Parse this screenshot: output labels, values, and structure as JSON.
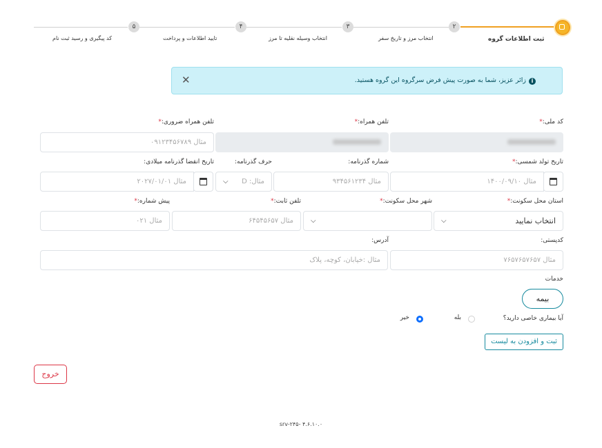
{
  "stepper": {
    "steps": [
      {
        "number": "",
        "label": "ثبت اطلاعات گروه"
      },
      {
        "number": "۲",
        "label": "انتخاب مرز و تاریخ سفر"
      },
      {
        "number": "۳",
        "label": "انتخاب وسیله نقلیه تا مرز"
      },
      {
        "number": "۴",
        "label": "تایید اطلاعات و پرداخت"
      },
      {
        "number": "۵",
        "label": "کد پیگیری و رسید ثبت نام"
      }
    ]
  },
  "alert": {
    "text": "زائر عزیز، شما به صورت پیش فرض سرگروه این گروه هستید.",
    "info_icon": "i",
    "close_icon": "✕"
  },
  "form": {
    "national_code": {
      "label": "کد ملی:",
      "required": "*"
    },
    "mobile": {
      "label": "تلفن همراه:",
      "required": "*"
    },
    "emergency_mobile": {
      "label": "تلفن همراه ضروری:",
      "required": "*",
      "placeholder": "مثال ۰۹۱۲۳۴۵۶۷۸۹"
    },
    "birth_date": {
      "label": "تاریخ تولد شمسی:",
      "required": "*",
      "placeholder": "مثال ۱۴۰۰/۰۹/۱۰"
    },
    "passport_number": {
      "label": "شماره گذرنامه:",
      "placeholder": "مثال ۹۳۴۵۶۱۲۳۴"
    },
    "passport_letter": {
      "label": "حرف گذرنامه:",
      "placeholder": "مثال: D"
    },
    "passport_expiry": {
      "label": "تاریخ انقضا گذرنامه میلادی:",
      "placeholder": "مثال ۲۰۲۷/۰۱/۰۱"
    },
    "province": {
      "label": "استان محل سکونت:",
      "required": "*",
      "value": "انتخاب نمایید"
    },
    "city": {
      "label": "شهر محل سکونت:",
      "required": "*",
      "value": ""
    },
    "phone": {
      "label": "تلفن ثابت:",
      "required": "*",
      "placeholder": "مثال ۶۴۵۴۵۶۵۷"
    },
    "area_code": {
      "label": "پیش شماره:",
      "required": "*",
      "placeholder": "مثال ۰۲۱"
    },
    "postal_code": {
      "label": "کدپستی:",
      "placeholder": "مثال ۷۶۵۷۶۵۷۶۵۷"
    },
    "address": {
      "label": "آدرس:",
      "placeholder": "مثال :خیابان، کوچه، پلاک"
    },
    "services_label": "خدمات",
    "insurance_button": "بیمه",
    "disease_question": "آیا بیماری خاصی دارید؟",
    "yes": "بله",
    "no": "خیر",
    "selected_option": "خیر",
    "add_button": "ثبت و افزودن به لیست"
  },
  "exit_button": "خروج",
  "footer": "srv-۲۴۵- ۴.۶.۱۰.۰"
}
